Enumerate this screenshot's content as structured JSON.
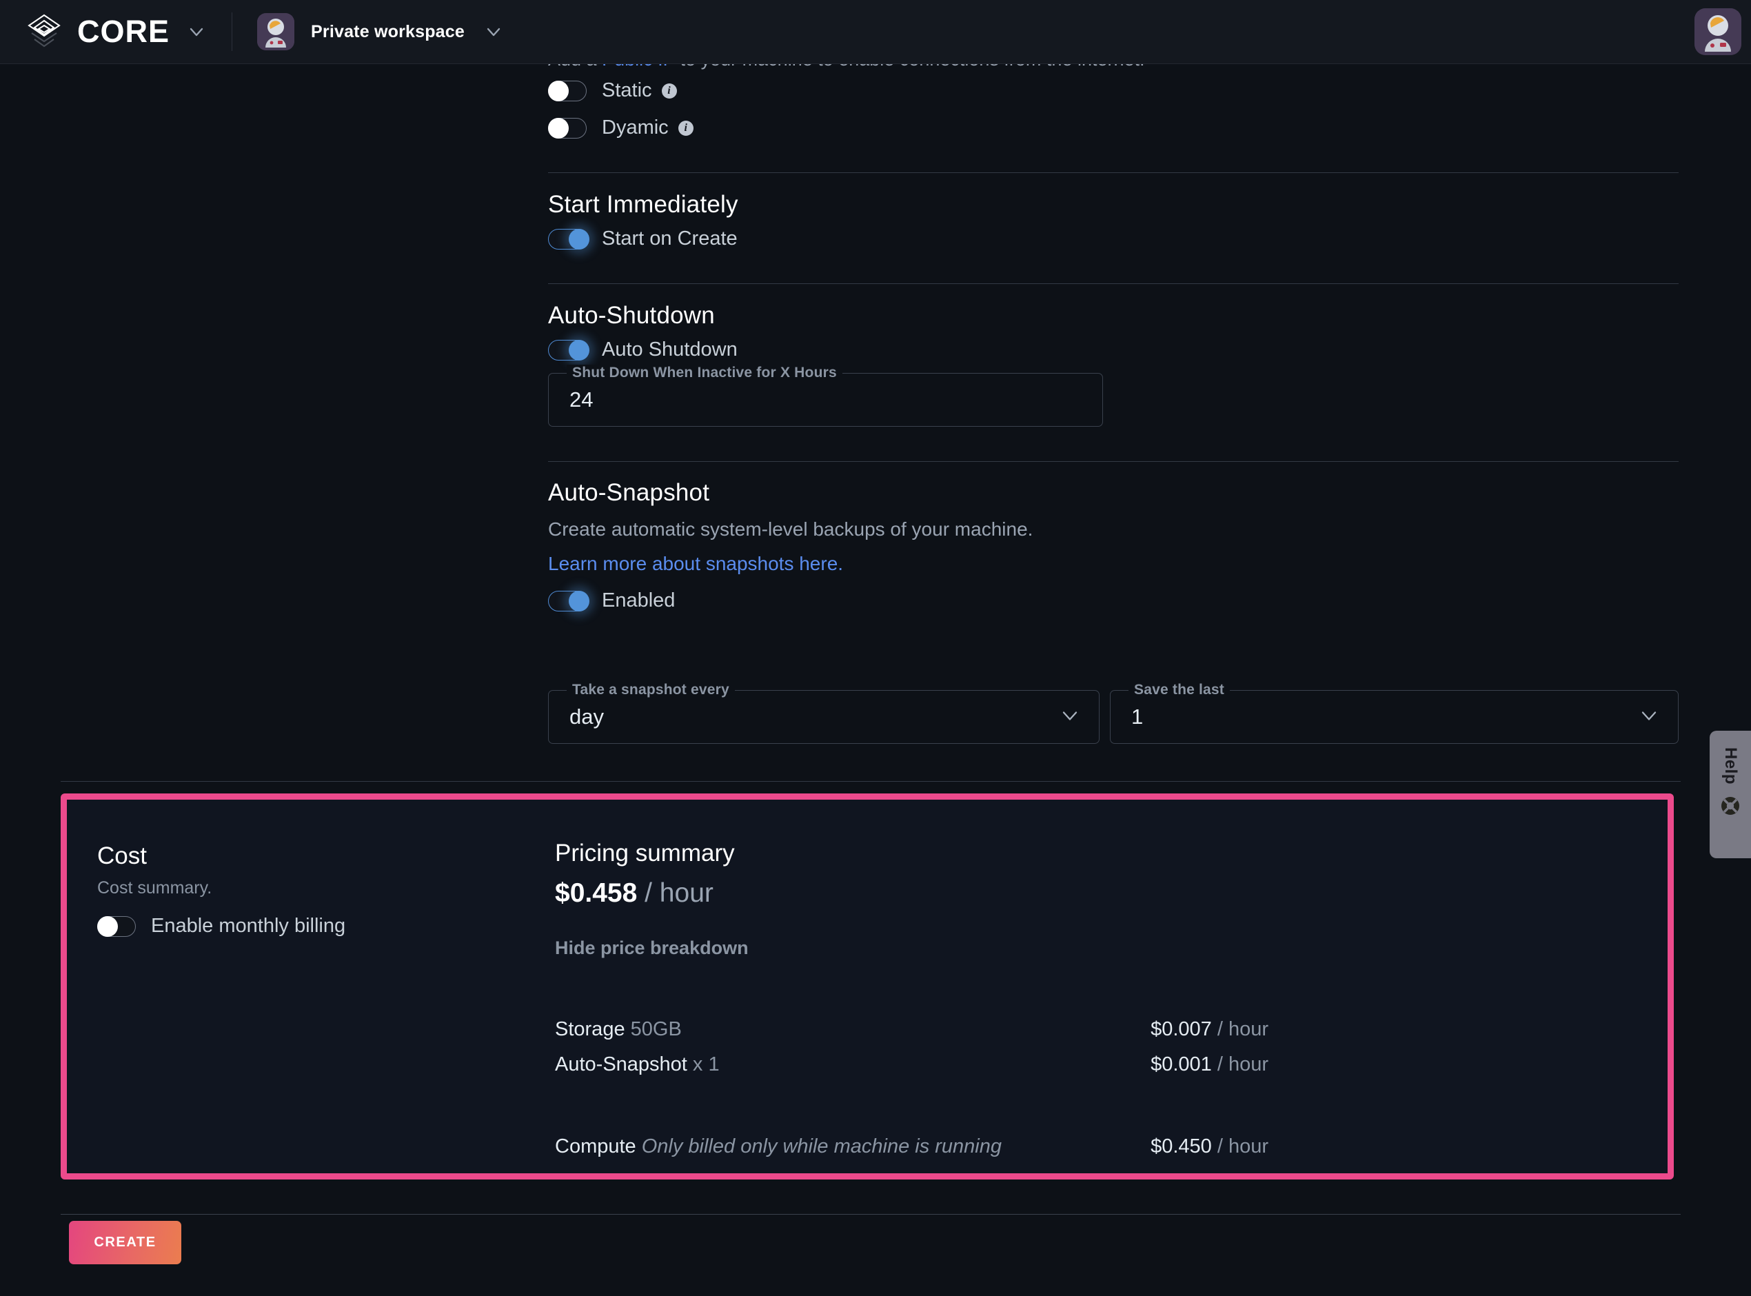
{
  "header": {
    "brand": "CORE",
    "brand_caret": "chevron-down",
    "workspace": "Private workspace",
    "workspace_caret": "chevron-down",
    "logo_icon": "stacked-layers-logo",
    "workspace_avatar_icon": "astronaut-avatar",
    "user_avatar_icon": "astronaut-avatar"
  },
  "public_ip": {
    "note_prefix": "Add a ",
    "note_link": "Public IP",
    "note_suffix": " to your machine to enable connections from the internet.",
    "static_label": "Static",
    "static_state": "off",
    "dynamic_label": "Dyamic",
    "dynamic_state": "off",
    "info_glyph": "i"
  },
  "start_immediately": {
    "title": "Start Immediately",
    "toggle_label": "Start on Create",
    "toggle_state": "on"
  },
  "auto_shutdown": {
    "title": "Auto-Shutdown",
    "toggle_label": "Auto Shutdown",
    "toggle_state": "on",
    "field_legend": "Shut Down When Inactive for X Hours",
    "field_value": "24"
  },
  "auto_snapshot": {
    "title": "Auto-Snapshot",
    "description": "Create automatic system-level backups of your machine.",
    "link": "Learn more about snapshots here.",
    "toggle_label": "Enabled",
    "toggle_state": "on",
    "frequency_legend": "Take a snapshot every",
    "frequency_value": "day",
    "retain_legend": "Save the last",
    "retain_value": "1"
  },
  "cost": {
    "title": "Cost",
    "subtitle": "Cost summary.",
    "monthly_billing_label": "Enable monthly billing",
    "monthly_billing_state": "off",
    "highlight_color": "#ec4a8c",
    "pricing_title": "Pricing summary",
    "total_price": "$0.458",
    "total_unit": "/ hour",
    "toggle_breakdown_label": "Hide price breakdown",
    "breakdown": [
      {
        "name": "Storage",
        "detail": "50GB",
        "detail_style": "muted",
        "price": "$0.007",
        "unit": "/ hour"
      },
      {
        "name": "Auto-Snapshot",
        "detail": "x 1",
        "detail_style": "muted",
        "price": "$0.001",
        "unit": "/ hour"
      },
      {
        "name": "Compute",
        "detail": "Only billed only while machine is running",
        "detail_style": "italic",
        "price": "$0.450",
        "unit": "/ hour"
      }
    ]
  },
  "actions": {
    "create_label": "CREATE"
  },
  "help": {
    "label": "Help",
    "icon": "lifebuoy-icon"
  }
}
